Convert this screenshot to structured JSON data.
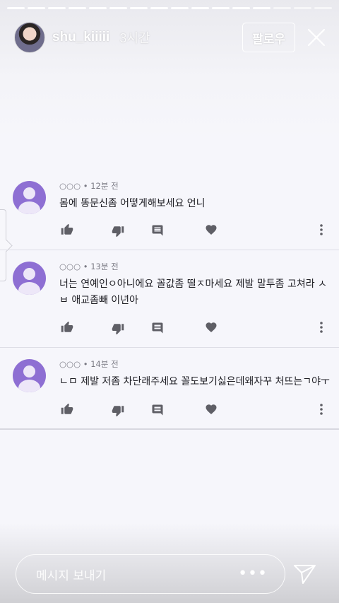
{
  "story": {
    "username": "shu_kiiiii",
    "time": "3시간",
    "follow_label": "팔로우",
    "progress_segments": 16,
    "progress_done": 13
  },
  "comments": [
    {
      "meta": "○○○ • 12분 전",
      "text": "몸에 똥문신좀 어떻게해보세요 언니"
    },
    {
      "meta": "○○○ • 13분 전",
      "text": "너는 연예인ㅇ아니에요 꼴값좀 떨ㅈ마세요 제발 말투좀 고쳐라 ㅅㅂ 애교좀빼 이년아"
    },
    {
      "meta": "○○○ • 14분 전",
      "text": "ㄴㅁ 제발 저좀 차단래주세요 꼴도보기싫은데왜자꾸 처뜨는ㄱ야ㅜ"
    }
  ],
  "message": {
    "placeholder": "메시지 보내기",
    "more_label": "•••"
  },
  "icons": [
    "close-icon",
    "thumbs-up-icon",
    "thumbs-down-icon",
    "reply-icon",
    "heart-icon",
    "more-vertical-icon",
    "send-icon"
  ],
  "colors": {
    "avatar": "#8e6fd3",
    "icon": "#5f5f66"
  }
}
